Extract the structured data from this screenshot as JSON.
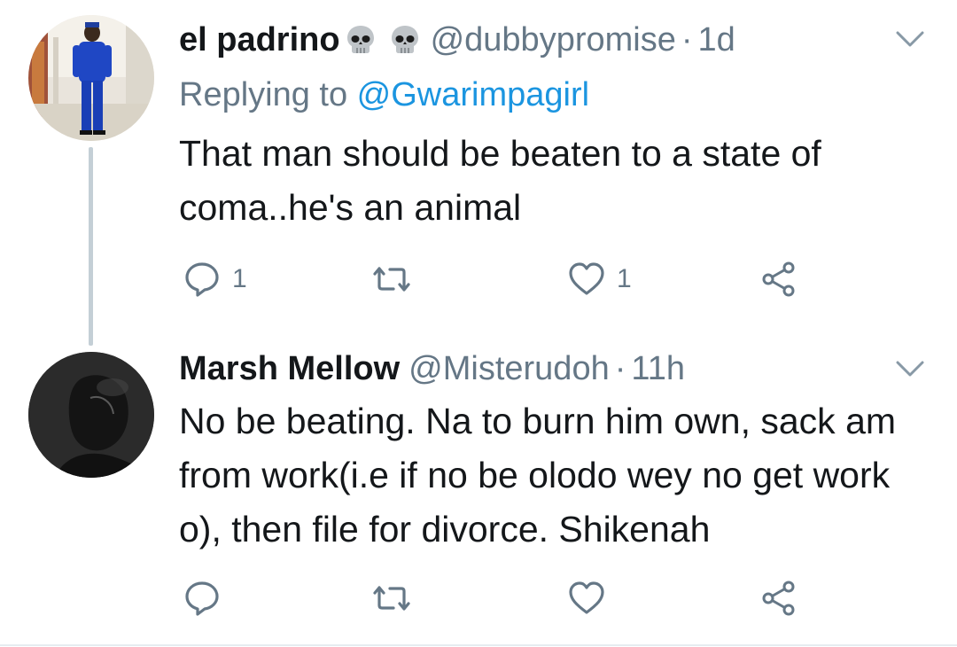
{
  "tweets": [
    {
      "name": "el padrino",
      "handle": "@dubbypromise",
      "separator": "·",
      "time": "1d",
      "replying_prefix": "Replying to ",
      "replying_to": "@Gwarimpagirl",
      "text": "That man should be beaten to a state of coma..he's an animal",
      "reply_count": "1",
      "retweet_count": "",
      "like_count": "1",
      "emoji_icons": [
        "skull-icon",
        "skull-icon"
      ]
    },
    {
      "name": "Marsh Mellow",
      "handle": "@Misterudoh",
      "separator": "·",
      "time": "11h",
      "text": "No be beating. Na to burn him own, sack am from work(i.e if no be olodo wey no get work o), then file for divorce. Shikenah",
      "reply_count": "",
      "retweet_count": "",
      "like_count": ""
    }
  ],
  "colors": {
    "primary_text": "#14171a",
    "secondary_text": "#657786",
    "link": "#1b95e0",
    "thread_line": "#c4cfd6"
  }
}
